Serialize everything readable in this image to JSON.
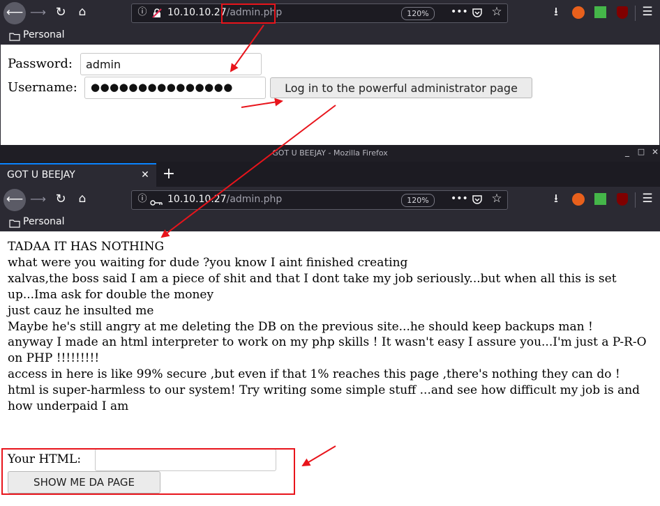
{
  "top_window": {
    "url_host": "10.10.10.27",
    "url_path": "/admin.php",
    "zoom": "120%",
    "bookmark": "Personal",
    "form": {
      "password_label": "Password:",
      "password_value": "admin",
      "username_label": "Username:",
      "username_value": "●●●●●●●●●●●●●●●",
      "submit_label": "Log in to the powerful administrator page"
    }
  },
  "bottom_window": {
    "title": "GOT U BEEJAY - Mozilla Firefox",
    "tab_title": "GOT U BEEJAY",
    "tab_close": "✕",
    "new_tab": "+",
    "url_host": "10.10.10.27",
    "url_path": "/admin.php",
    "zoom": "120%",
    "bookmark": "Personal",
    "content": {
      "lines": [
        "TADAA IT HAS NOTHING",
        "what were you waiting for dude ?you know I aint finished creating",
        "xalvas,the boss said I am a piece of shit and that I dont take my job seriously...but when all this is set up...Ima ask for double the money",
        "just cauz he insulted me",
        "Maybe he's still angry at me deleting the DB on the previous site...he should keep backups man !",
        "anyway I made an html interpreter to work on my php skills ! It wasn't easy I assure you...I'm just a P-R-O on PHP !!!!!!!!!",
        "access in here is like 99% secure ,but even if that 1% reaches this page ,there's nothing they can do !",
        "html is super-harmless to our system! Try writing some simple stuff ...and see how difficult my job is and how underpaid I am"
      ],
      "html_label": "Your HTML:",
      "html_value": "",
      "show_button": "SHOW ME DA PAGE"
    }
  },
  "colors": {
    "toolbar_bg": "#2b2a33",
    "tab_accent": "#0a84ff",
    "annotation": "#e8141b"
  }
}
